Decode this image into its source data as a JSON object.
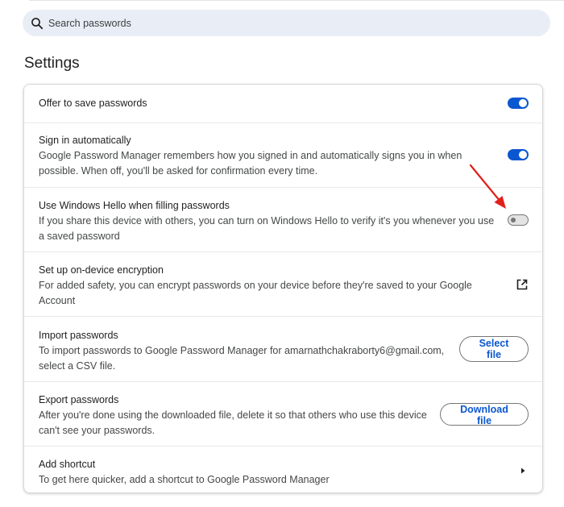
{
  "search": {
    "placeholder": "Search passwords"
  },
  "page": {
    "title": "Settings"
  },
  "settings": {
    "offer_save": {
      "title": "Offer to save passwords",
      "enabled": true
    },
    "sign_in_auto": {
      "title": "Sign in automatically",
      "desc_line1": "Google Password Manager remembers how you signed in and automatically signs you in when",
      "desc_line2": "possible. When off, you'll be asked for confirmation every time.",
      "enabled": true
    },
    "windows_hello": {
      "title": "Use Windows Hello when filling passwords",
      "desc_line1": "If you share this device with others, you can turn on Windows Hello to verify it's you whenever you use",
      "desc_line2": "a saved password",
      "enabled": false
    },
    "encryption": {
      "title": "Set up on-device encryption",
      "desc_line1": "For added safety, you can encrypt passwords on your device before they're saved to your Google",
      "desc_line2": "Account",
      "icon": "open-in-new-icon"
    },
    "import": {
      "title": "Import passwords",
      "desc_line1": "To import passwords to Google Password Manager for amarnathchakraborty6@gmail.com,",
      "desc_line2": "select a CSV file.",
      "button_label": "Select file"
    },
    "export": {
      "title": "Export passwords",
      "desc_line1": "After you're done using the downloaded file, delete it so that others who use this device",
      "desc_line2": "can't see your passwords.",
      "button_label": "Download file"
    },
    "shortcut": {
      "title": "Add shortcut",
      "desc_line1": "To get here quicker, add a shortcut to Google Password Manager",
      "icon": "chevron-right-icon"
    }
  },
  "colors": {
    "accent": "#0b57d0",
    "annotation_arrow": "#e0201b"
  }
}
